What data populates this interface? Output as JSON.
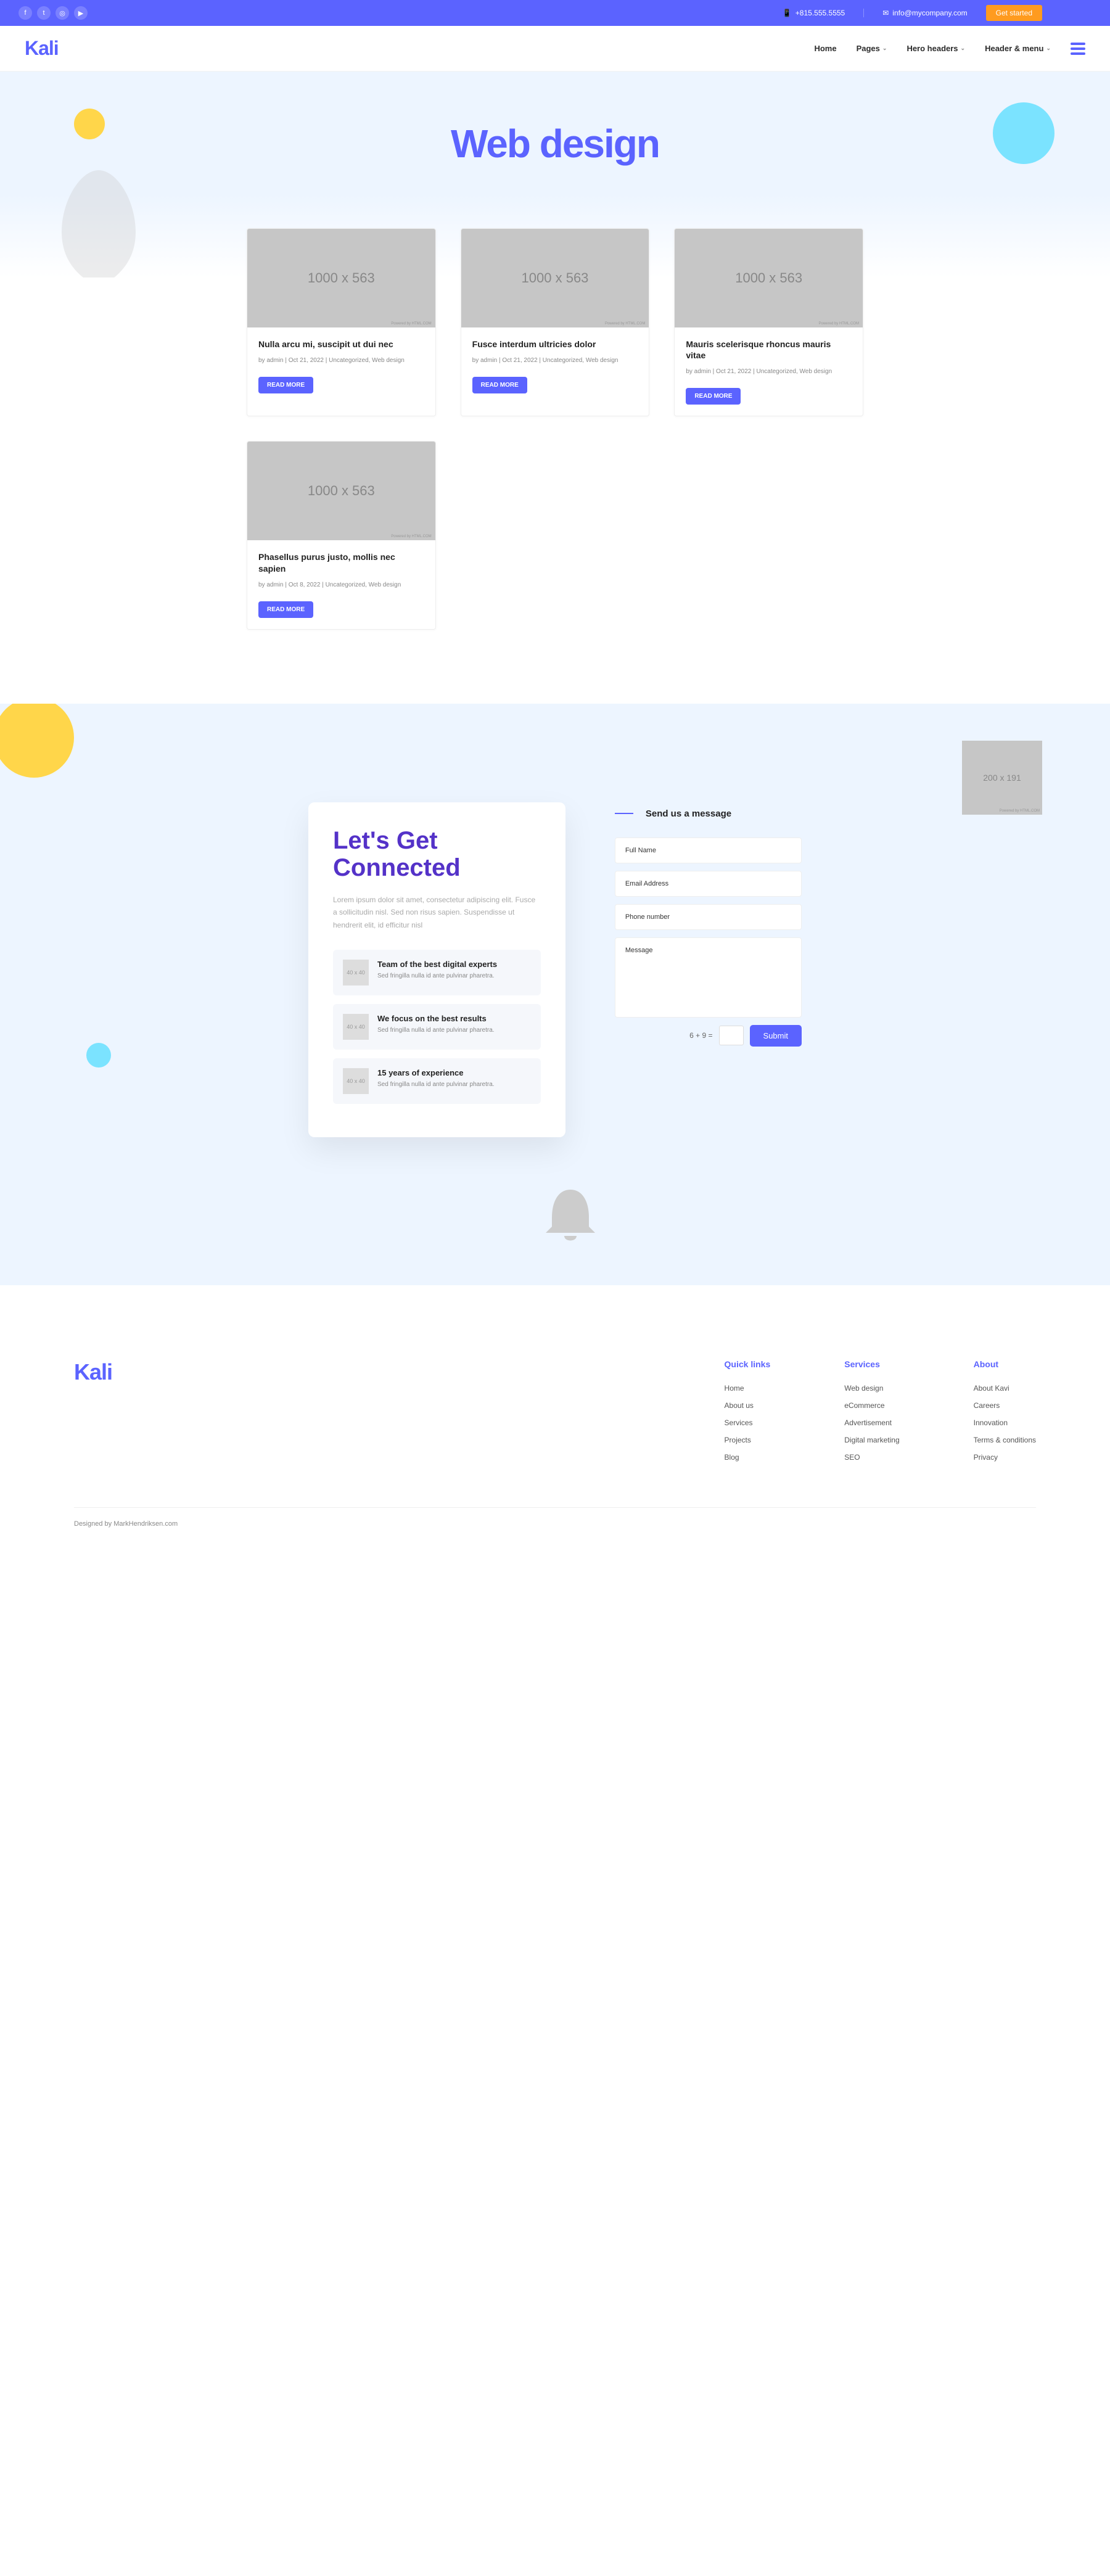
{
  "topbar": {
    "phone": "+815.555.5555",
    "email": "info@mycompany.com",
    "cta": "Get started"
  },
  "header": {
    "logo": "Kali",
    "nav": [
      "Home",
      "Pages",
      "Hero headers",
      "Header & menu"
    ]
  },
  "hero": {
    "title": "Web design"
  },
  "placeholder_large": "1000 x 563",
  "placeholder_small": "200 x 191",
  "posts": [
    {
      "title": "Nulla arcu mi, suscipit ut dui nec",
      "meta": "by admin | Oct 21, 2022 | Uncategorized, Web design",
      "button": "READ MORE"
    },
    {
      "title": "Fusce interdum ultricies dolor",
      "meta": "by admin | Oct 21, 2022 | Uncategorized, Web design",
      "button": "READ MORE"
    },
    {
      "title": "Mauris scelerisque rhoncus mauris vitae",
      "meta": "by admin | Oct 21, 2022 | Uncategorized, Web design",
      "button": "READ MORE"
    },
    {
      "title": "Phasellus purus justo, mollis nec sapien",
      "meta": "by admin | Oct 8, 2022 | Uncategorized, Web design",
      "button": "READ MORE"
    }
  ],
  "connected": {
    "heading": "Let's Get Connected",
    "intro": "Lorem ipsum dolor sit amet, consectetur adipiscing elit. Fusce a sollicitudin nisl. Sed non risus sapien. Suspendisse ut hendrerit elit, id efficitur nisl",
    "features": [
      {
        "title": "Team of the best digital experts",
        "text": "Sed fringilla nulla id ante pulvinar pharetra."
      },
      {
        "title": "We focus on the best results",
        "text": "Sed fringilla nulla id ante pulvinar pharetra."
      },
      {
        "title": "15 years of experience",
        "text": "Sed fringilla nulla id ante pulvinar pharetra."
      }
    ],
    "form_title": "Send us a message",
    "fields": {
      "name": "Full Name",
      "email": "Email Address",
      "phone": "Phone number",
      "message": "Message"
    },
    "captcha": "6 + 9 =",
    "submit": "Submit"
  },
  "footer": {
    "logo": "Kali",
    "cols": [
      {
        "title": "Quick links",
        "links": [
          "Home",
          "About us",
          "Services",
          "Projects",
          "Blog"
        ]
      },
      {
        "title": "Services",
        "links": [
          "Web design",
          "eCommerce",
          "Advertisement",
          "Digital marketing",
          "SEO"
        ]
      },
      {
        "title": "About",
        "links": [
          "About Kavi",
          "Careers",
          "Innovation",
          "Terms & conditions",
          "Privacy"
        ]
      }
    ],
    "credit": "Designed by MarkHendriksen.com"
  },
  "icon_placeholder": "40 x 40"
}
